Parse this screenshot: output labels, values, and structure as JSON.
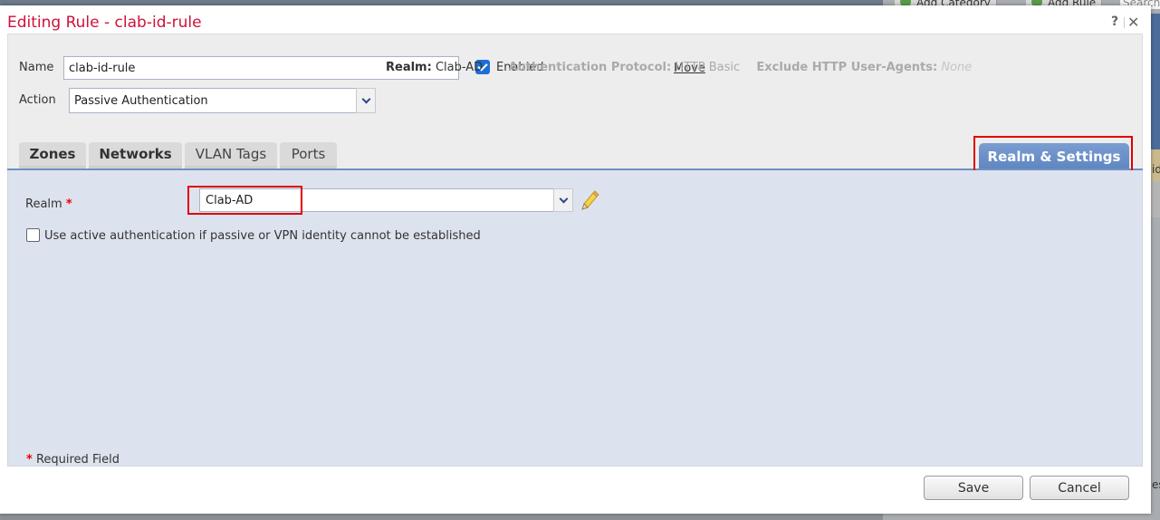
{
  "background_app": {
    "add_category_label": "Add Category",
    "add_rule_label": "Add Rule",
    "search_placeholder": "Search",
    "side_text_1": "id",
    "side_text_2": "es"
  },
  "dialog": {
    "title": "Editing Rule - clab-id-rule",
    "help_label": "?",
    "close_label": "✕"
  },
  "form": {
    "name_label": "Name",
    "name_value": "clab-id-rule",
    "enabled_label": "Enabled",
    "enabled_checked": true,
    "move_label": "Move",
    "action_label": "Action",
    "action_value": "Passive Authentication",
    "summary": {
      "realm_key": "Realm:",
      "realm_value": "Clab-AD",
      "auth_protocol_key": "Authentication Protocol:",
      "auth_protocol_value": "HTTP Basic",
      "exclude_key": "Exclude HTTP User-Agents:",
      "exclude_value": "None"
    }
  },
  "tabs": [
    {
      "label": "Zones"
    },
    {
      "label": "Networks"
    },
    {
      "label": "VLAN Tags"
    },
    {
      "label": "Ports"
    },
    {
      "label": "Realm & Settings",
      "active": true
    }
  ],
  "realm_settings": {
    "realm_label": "Realm",
    "required_mark": "*",
    "realm_value": "Clab-AD",
    "active_auth_label": "Use active authentication if passive or VPN identity cannot be established",
    "active_auth_checked": false,
    "required_note": "Required Field"
  },
  "footer": {
    "save_label": "Save",
    "cancel_label": "Cancel"
  },
  "colors": {
    "title": "#d0103a",
    "active_tab": "#6a90c8",
    "highlight": "#e00000"
  }
}
